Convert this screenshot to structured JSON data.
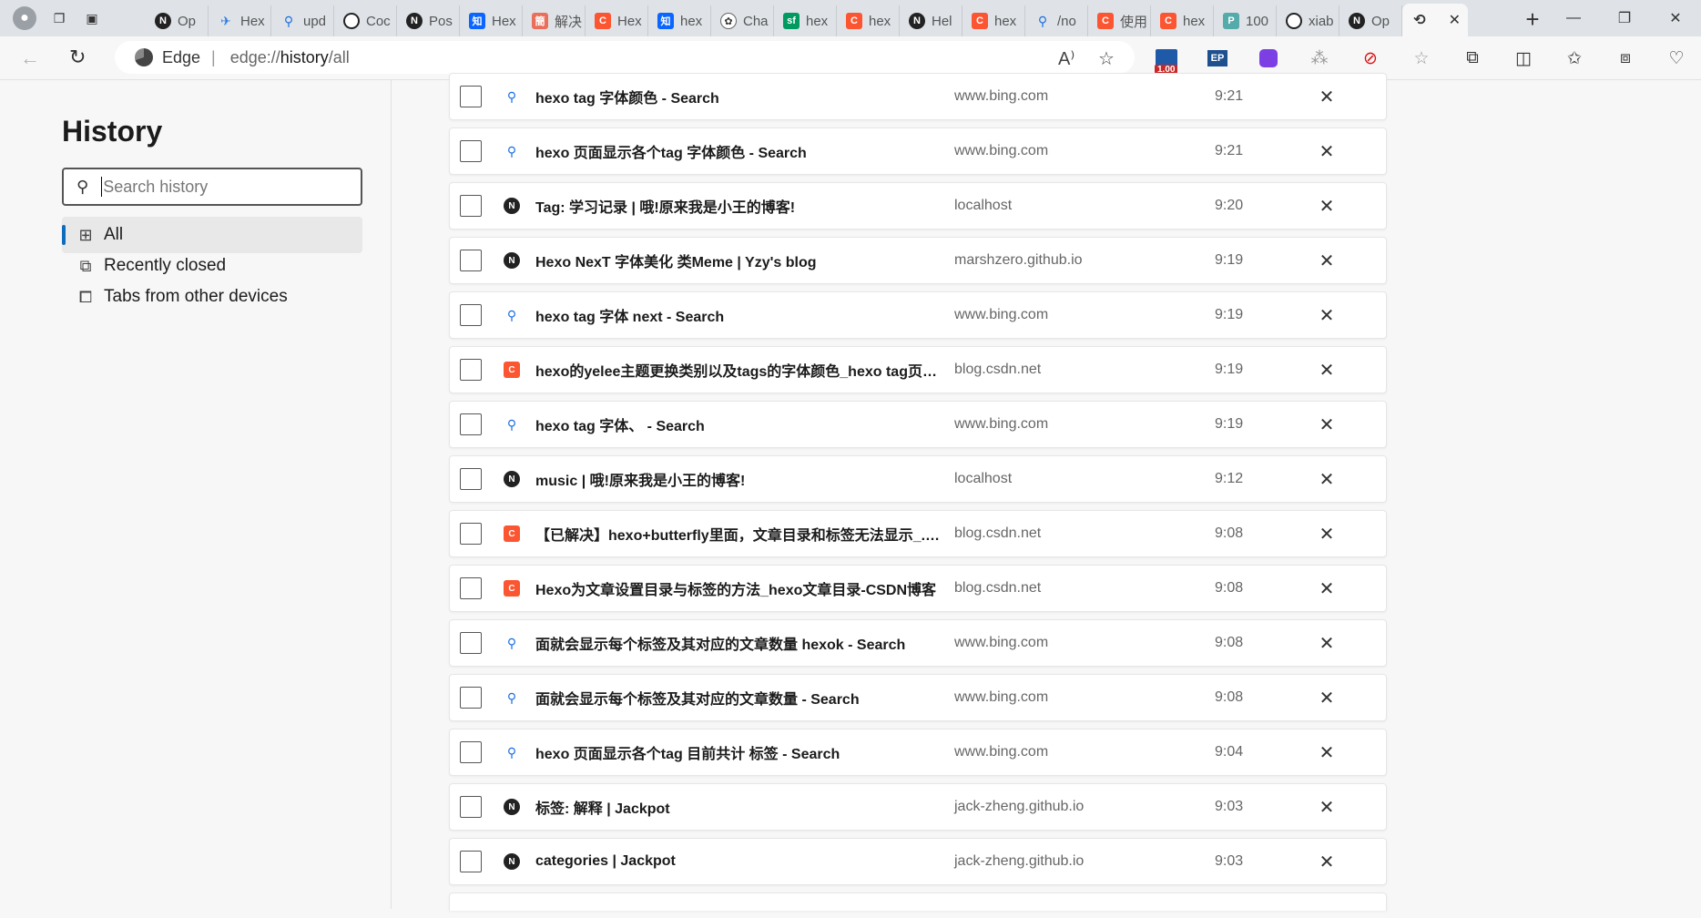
{
  "tabs": [
    {
      "icon": "n",
      "label": "Op"
    },
    {
      "icon": "bird",
      "label": "Hex"
    },
    {
      "icon": "srch",
      "label": "upd"
    },
    {
      "icon": "gh",
      "label": "Coc"
    },
    {
      "icon": "n",
      "label": "Pos"
    },
    {
      "icon": "zhi",
      "glyph": "知",
      "label": "Hex"
    },
    {
      "icon": "jian",
      "glyph": "簡",
      "label": "解决"
    },
    {
      "icon": "c",
      "glyph": "C",
      "label": "Hex"
    },
    {
      "icon": "zhi",
      "glyph": "知",
      "label": "hex"
    },
    {
      "icon": "gpt",
      "glyph": "✿",
      "label": "Cha"
    },
    {
      "icon": "sf",
      "glyph": "sf",
      "label": "hex"
    },
    {
      "icon": "c",
      "glyph": "C",
      "label": "hex"
    },
    {
      "icon": "n",
      "label": "Hel"
    },
    {
      "icon": "c",
      "glyph": "C",
      "label": "hex"
    },
    {
      "icon": "srch",
      "label": "/no"
    },
    {
      "icon": "c",
      "glyph": "C",
      "label": "使用"
    },
    {
      "icon": "c",
      "glyph": "C",
      "label": "hex"
    },
    {
      "icon": "pbg",
      "glyph": "P",
      "label": "100"
    },
    {
      "icon": "gh",
      "label": "xiab"
    },
    {
      "icon": "n",
      "label": "Op"
    }
  ],
  "address": {
    "site": "Edge",
    "url_prefix": "edge://",
    "url_main": "history",
    "url_suffix": "/all"
  },
  "extensions": {
    "badge": "1.00"
  },
  "sidebar": {
    "title": "History",
    "search_placeholder": "Search history",
    "nav": [
      {
        "label": "All"
      },
      {
        "label": "Recently closed"
      },
      {
        "label": "Tabs from other devices"
      }
    ]
  },
  "history": [
    {
      "icon": "bing",
      "title": "hexo tag 字体颜色 - Search",
      "domain": "www.bing.com",
      "time": "9:21"
    },
    {
      "icon": "bing",
      "title": "hexo 页面显示各个tag 字体颜色 - Search",
      "domain": "www.bing.com",
      "time": "9:21"
    },
    {
      "icon": "n",
      "title": "Tag: 学习记录 | 哦!原来我是小王的博客!",
      "domain": "localhost",
      "time": "9:20"
    },
    {
      "icon": "n",
      "title": "Hexo NexT 字体美化 类Meme | Yzy's blog",
      "domain": "marshzero.github.io",
      "time": "9:19"
    },
    {
      "icon": "bing",
      "title": "hexo tag 字体 next - Search",
      "domain": "www.bing.com",
      "time": "9:19"
    },
    {
      "icon": "c",
      "title": "hexo的yelee主题更换类别以及tags的字体颜色_hexo tag页面 ...",
      "domain": "blog.csdn.net",
      "time": "9:19"
    },
    {
      "icon": "bing",
      "title": "hexo tag 字体、 - Search",
      "domain": "www.bing.com",
      "time": "9:19"
    },
    {
      "icon": "n",
      "title": "music | 哦!原来我是小王的博客!",
      "domain": "localhost",
      "time": "9:12"
    },
    {
      "icon": "c",
      "title": "【已解决】hexo+butterfly里面，文章目录和标签无法显示_.m...",
      "domain": "blog.csdn.net",
      "time": "9:08"
    },
    {
      "icon": "c",
      "title": "Hexo为文章设置目录与标签的方法_hexo文章目录-CSDN博客",
      "domain": "blog.csdn.net",
      "time": "9:08"
    },
    {
      "icon": "bing",
      "title": "面就会显示每个标签及其对应的文章数量 hexok - Search",
      "domain": "www.bing.com",
      "time": "9:08"
    },
    {
      "icon": "bing",
      "title": "面就会显示每个标签及其对应的文章数量 - Search",
      "domain": "www.bing.com",
      "time": "9:08"
    },
    {
      "icon": "bing",
      "title": "hexo 页面显示各个tag 目前共计 标签 - Search",
      "domain": "www.bing.com",
      "time": "9:04"
    },
    {
      "icon": "n",
      "title": "标签: 解释 | Jackpot",
      "domain": "jack-zheng.github.io",
      "time": "9:03"
    },
    {
      "icon": "n",
      "title": "categories | Jackpot",
      "domain": "jack-zheng.github.io",
      "time": "9:03"
    }
  ]
}
